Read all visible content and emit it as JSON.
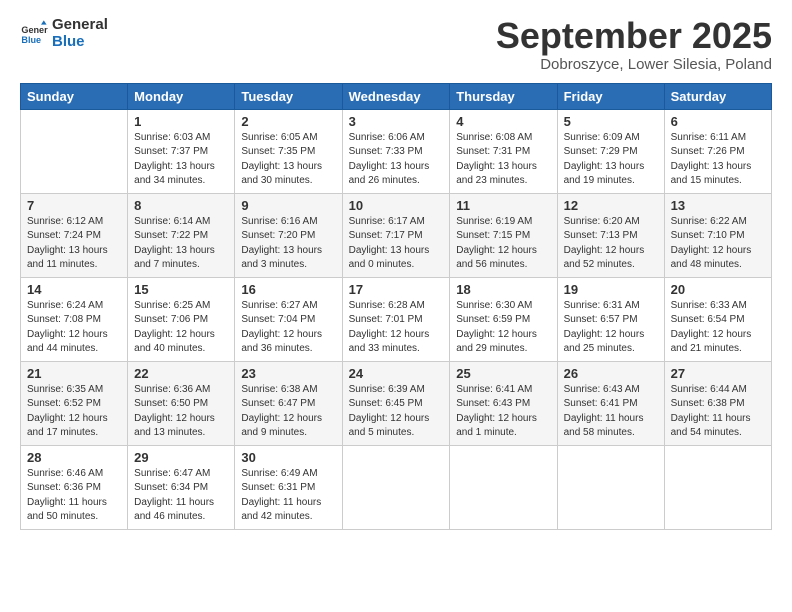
{
  "logo": {
    "line1": "General",
    "line2": "Blue"
  },
  "title": "September 2025",
  "location": "Dobroszyce, Lower Silesia, Poland",
  "days_of_week": [
    "Sunday",
    "Monday",
    "Tuesday",
    "Wednesday",
    "Thursday",
    "Friday",
    "Saturday"
  ],
  "weeks": [
    [
      {
        "day": "",
        "info": ""
      },
      {
        "day": "1",
        "info": "Sunrise: 6:03 AM\nSunset: 7:37 PM\nDaylight: 13 hours\nand 34 minutes."
      },
      {
        "day": "2",
        "info": "Sunrise: 6:05 AM\nSunset: 7:35 PM\nDaylight: 13 hours\nand 30 minutes."
      },
      {
        "day": "3",
        "info": "Sunrise: 6:06 AM\nSunset: 7:33 PM\nDaylight: 13 hours\nand 26 minutes."
      },
      {
        "day": "4",
        "info": "Sunrise: 6:08 AM\nSunset: 7:31 PM\nDaylight: 13 hours\nand 23 minutes."
      },
      {
        "day": "5",
        "info": "Sunrise: 6:09 AM\nSunset: 7:29 PM\nDaylight: 13 hours\nand 19 minutes."
      },
      {
        "day": "6",
        "info": "Sunrise: 6:11 AM\nSunset: 7:26 PM\nDaylight: 13 hours\nand 15 minutes."
      }
    ],
    [
      {
        "day": "7",
        "info": "Sunrise: 6:12 AM\nSunset: 7:24 PM\nDaylight: 13 hours\nand 11 minutes."
      },
      {
        "day": "8",
        "info": "Sunrise: 6:14 AM\nSunset: 7:22 PM\nDaylight: 13 hours\nand 7 minutes."
      },
      {
        "day": "9",
        "info": "Sunrise: 6:16 AM\nSunset: 7:20 PM\nDaylight: 13 hours\nand 3 minutes."
      },
      {
        "day": "10",
        "info": "Sunrise: 6:17 AM\nSunset: 7:17 PM\nDaylight: 13 hours\nand 0 minutes."
      },
      {
        "day": "11",
        "info": "Sunrise: 6:19 AM\nSunset: 7:15 PM\nDaylight: 12 hours\nand 56 minutes."
      },
      {
        "day": "12",
        "info": "Sunrise: 6:20 AM\nSunset: 7:13 PM\nDaylight: 12 hours\nand 52 minutes."
      },
      {
        "day": "13",
        "info": "Sunrise: 6:22 AM\nSunset: 7:10 PM\nDaylight: 12 hours\nand 48 minutes."
      }
    ],
    [
      {
        "day": "14",
        "info": "Sunrise: 6:24 AM\nSunset: 7:08 PM\nDaylight: 12 hours\nand 44 minutes."
      },
      {
        "day": "15",
        "info": "Sunrise: 6:25 AM\nSunset: 7:06 PM\nDaylight: 12 hours\nand 40 minutes."
      },
      {
        "day": "16",
        "info": "Sunrise: 6:27 AM\nSunset: 7:04 PM\nDaylight: 12 hours\nand 36 minutes."
      },
      {
        "day": "17",
        "info": "Sunrise: 6:28 AM\nSunset: 7:01 PM\nDaylight: 12 hours\nand 33 minutes."
      },
      {
        "day": "18",
        "info": "Sunrise: 6:30 AM\nSunset: 6:59 PM\nDaylight: 12 hours\nand 29 minutes."
      },
      {
        "day": "19",
        "info": "Sunrise: 6:31 AM\nSunset: 6:57 PM\nDaylight: 12 hours\nand 25 minutes."
      },
      {
        "day": "20",
        "info": "Sunrise: 6:33 AM\nSunset: 6:54 PM\nDaylight: 12 hours\nand 21 minutes."
      }
    ],
    [
      {
        "day": "21",
        "info": "Sunrise: 6:35 AM\nSunset: 6:52 PM\nDaylight: 12 hours\nand 17 minutes."
      },
      {
        "day": "22",
        "info": "Sunrise: 6:36 AM\nSunset: 6:50 PM\nDaylight: 12 hours\nand 13 minutes."
      },
      {
        "day": "23",
        "info": "Sunrise: 6:38 AM\nSunset: 6:47 PM\nDaylight: 12 hours\nand 9 minutes."
      },
      {
        "day": "24",
        "info": "Sunrise: 6:39 AM\nSunset: 6:45 PM\nDaylight: 12 hours\nand 5 minutes."
      },
      {
        "day": "25",
        "info": "Sunrise: 6:41 AM\nSunset: 6:43 PM\nDaylight: 12 hours\nand 1 minute."
      },
      {
        "day": "26",
        "info": "Sunrise: 6:43 AM\nSunset: 6:41 PM\nDaylight: 11 hours\nand 58 minutes."
      },
      {
        "day": "27",
        "info": "Sunrise: 6:44 AM\nSunset: 6:38 PM\nDaylight: 11 hours\nand 54 minutes."
      }
    ],
    [
      {
        "day": "28",
        "info": "Sunrise: 6:46 AM\nSunset: 6:36 PM\nDaylight: 11 hours\nand 50 minutes."
      },
      {
        "day": "29",
        "info": "Sunrise: 6:47 AM\nSunset: 6:34 PM\nDaylight: 11 hours\nand 46 minutes."
      },
      {
        "day": "30",
        "info": "Sunrise: 6:49 AM\nSunset: 6:31 PM\nDaylight: 11 hours\nand 42 minutes."
      },
      {
        "day": "",
        "info": ""
      },
      {
        "day": "",
        "info": ""
      },
      {
        "day": "",
        "info": ""
      },
      {
        "day": "",
        "info": ""
      }
    ]
  ]
}
